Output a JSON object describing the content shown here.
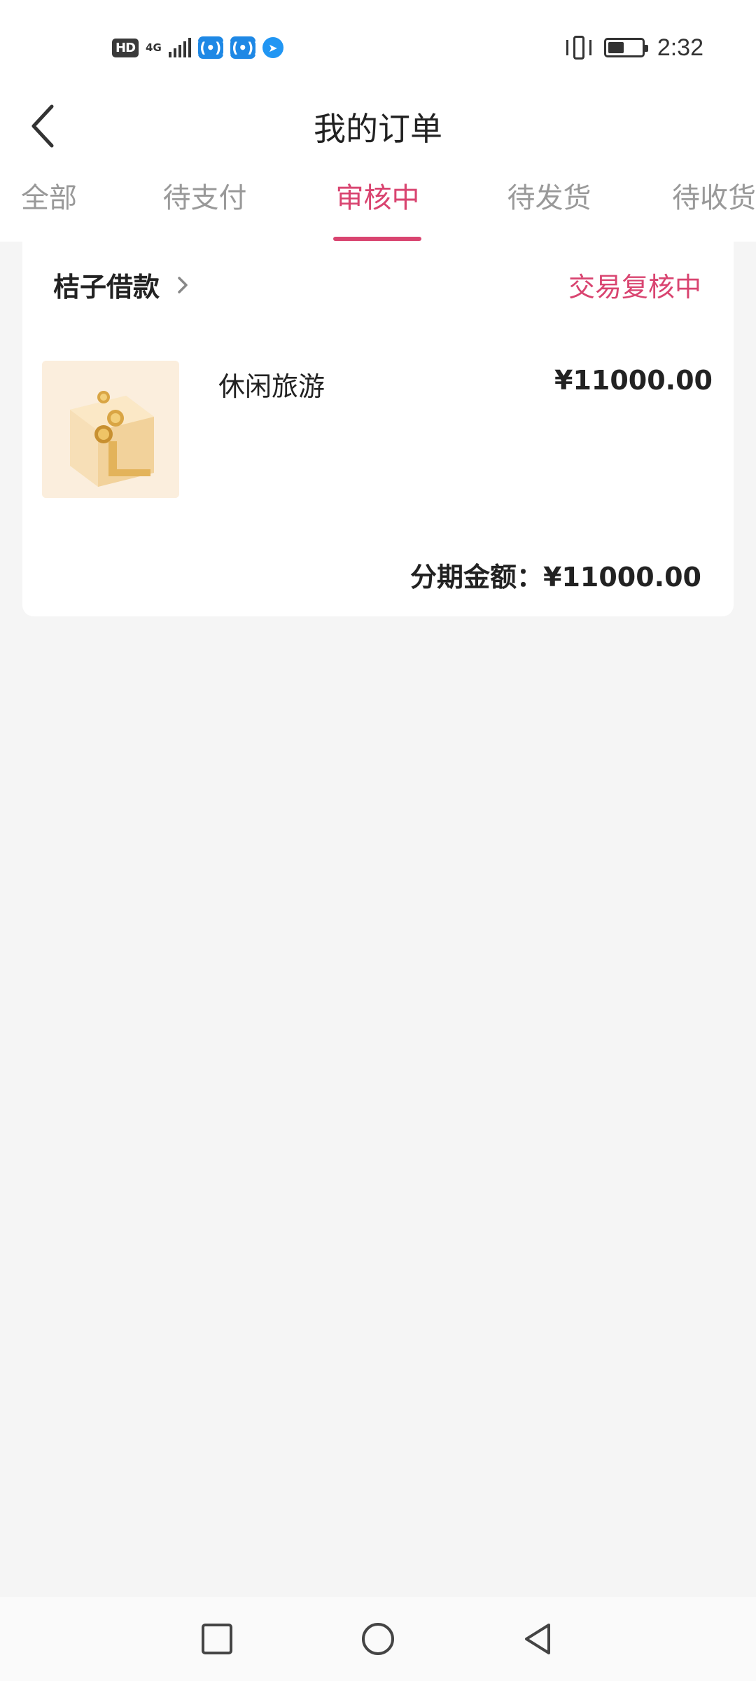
{
  "status_bar": {
    "left_badges": [
      "HD",
      "4G"
    ],
    "time": "2:32",
    "icons": [
      "signal-icon",
      "wifi-calling-icon",
      "wifi-calling-icon",
      "browser-icon",
      "vibrate-icon",
      "battery-icon"
    ]
  },
  "header": {
    "title": "我的订单",
    "back_icon": "chevron-left-icon"
  },
  "tabs": [
    {
      "label": "全部",
      "active": false
    },
    {
      "label": "待支付",
      "active": false
    },
    {
      "label": "审核中",
      "active": true
    },
    {
      "label": "待发货",
      "active": false
    },
    {
      "label": "待收货",
      "active": false
    }
  ],
  "order": {
    "shop_name": "桔子借款",
    "status": "交易复核中",
    "product": {
      "name": "休闲旅游",
      "price": "¥11000.00",
      "image_icon": "gold-coins-box-icon"
    },
    "total_label": "分期金额：",
    "total_value": "¥11000.00"
  },
  "system_nav": [
    "recent-apps-icon",
    "home-icon",
    "back-icon"
  ],
  "colors": {
    "accent": "#d94470",
    "background": "#f5f5f5",
    "card": "#ffffff",
    "muted_text": "#999999"
  }
}
